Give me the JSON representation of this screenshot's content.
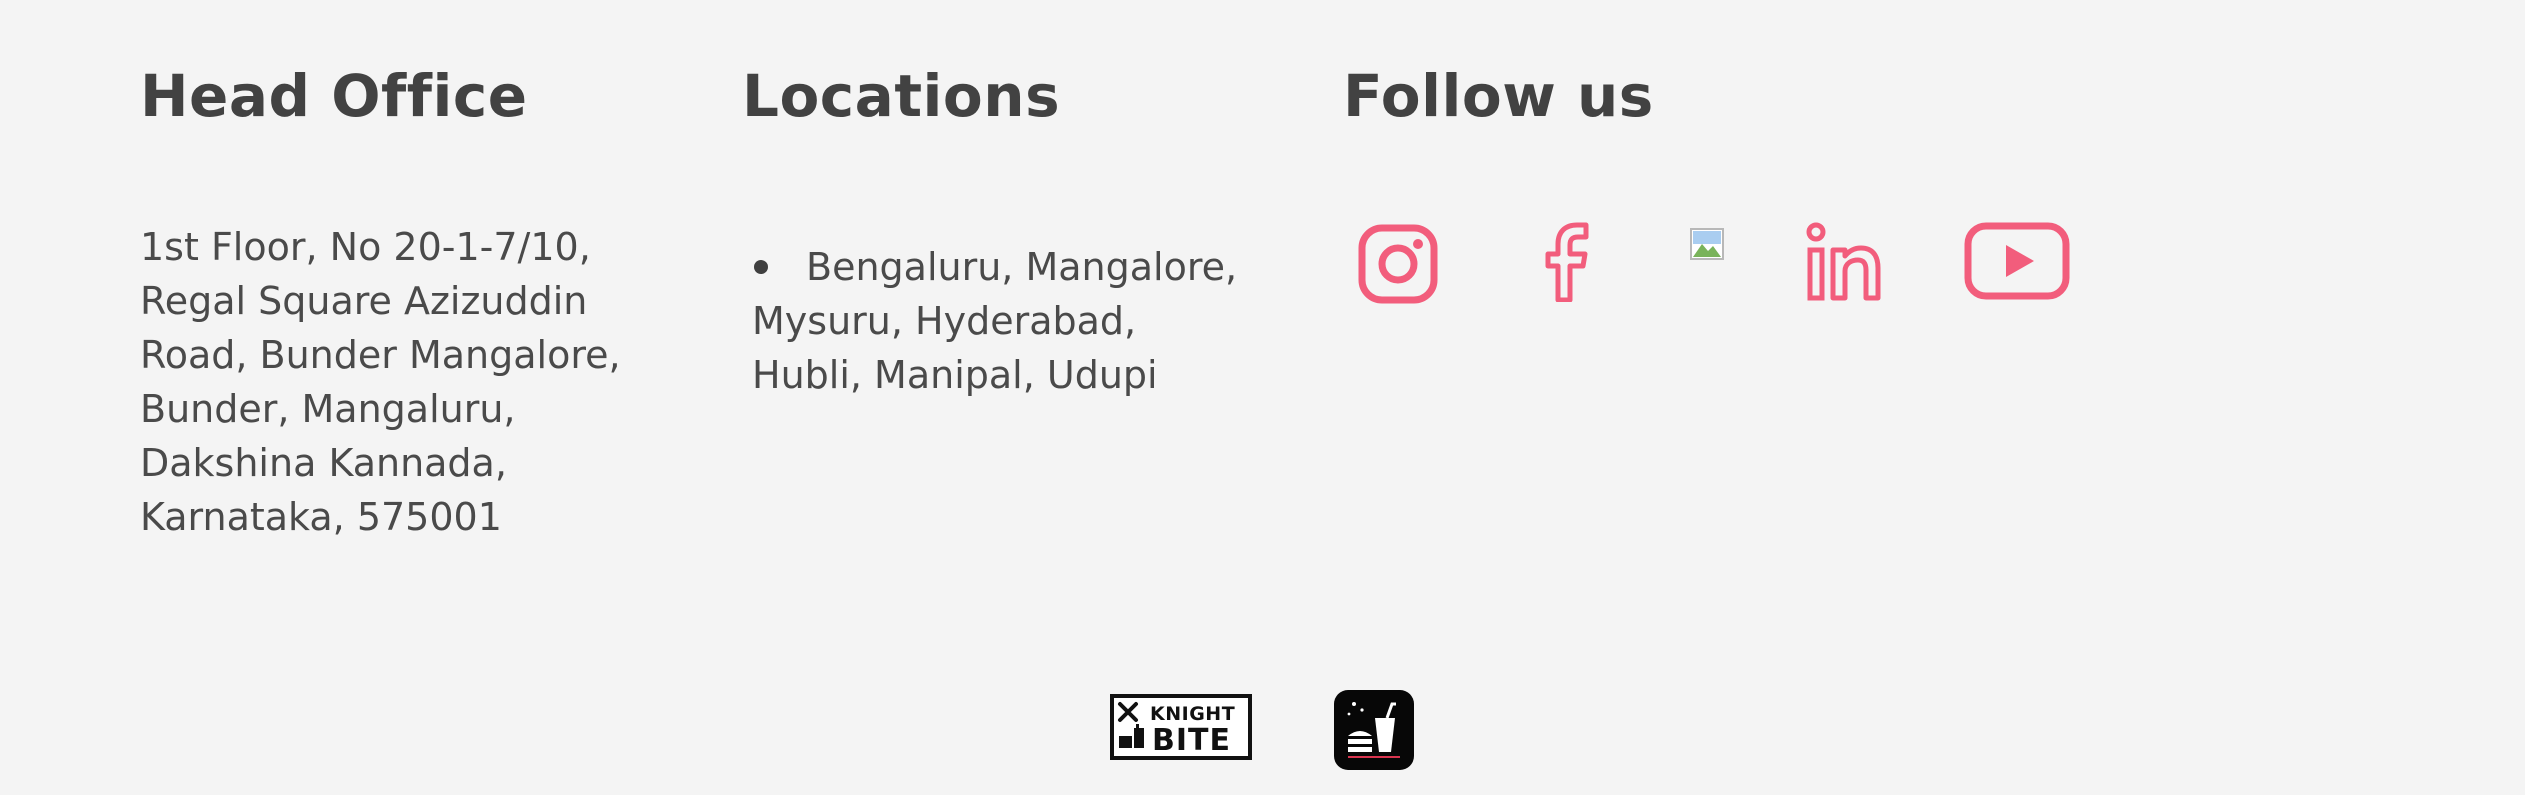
{
  "head_office": {
    "title": "Head Office",
    "address_lines": [
      "1st Floor, No 20-1-7/10,",
      "Regal Square Azizuddin",
      "Road, Bunder Mangalore,",
      "Bunder, Mangaluru,",
      "Dakshina Kannada,",
      "Karnataka, 575001"
    ]
  },
  "locations": {
    "title": "Locations",
    "lines": [
      "Bengaluru, Mangalore,",
      "Mysuru, Hyderabad,",
      "Hubli, Manipal, Udupi"
    ]
  },
  "follow": {
    "title": "Follow us",
    "icons": [
      "instagram-icon",
      "facebook-icon",
      "twitter-icon",
      "linkedin-icon",
      "youtube-icon"
    ],
    "accent_color": "#f25d7c"
  },
  "branding": {
    "wordmark_top": "KNIGHT",
    "wordmark_bottom": "BITE",
    "colors": {
      "background": "#f4f4f4",
      "text": "#424242",
      "logo": "#111111"
    }
  }
}
